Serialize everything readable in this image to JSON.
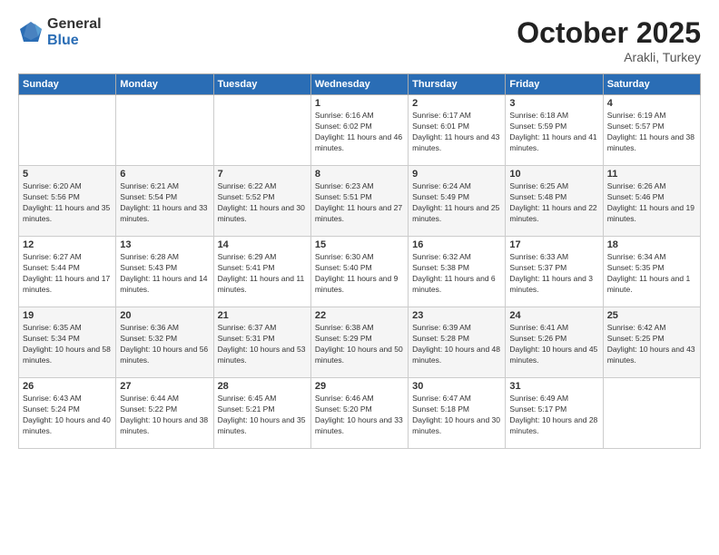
{
  "logo": {
    "general": "General",
    "blue": "Blue"
  },
  "header": {
    "month": "October 2025",
    "location": "Arakli, Turkey"
  },
  "weekdays": [
    "Sunday",
    "Monday",
    "Tuesday",
    "Wednesday",
    "Thursday",
    "Friday",
    "Saturday"
  ],
  "weeks": [
    [
      {
        "day": "",
        "sunrise": "",
        "sunset": "",
        "daylight": ""
      },
      {
        "day": "",
        "sunrise": "",
        "sunset": "",
        "daylight": ""
      },
      {
        "day": "",
        "sunrise": "",
        "sunset": "",
        "daylight": ""
      },
      {
        "day": "1",
        "sunrise": "Sunrise: 6:16 AM",
        "sunset": "Sunset: 6:02 PM",
        "daylight": "Daylight: 11 hours and 46 minutes."
      },
      {
        "day": "2",
        "sunrise": "Sunrise: 6:17 AM",
        "sunset": "Sunset: 6:01 PM",
        "daylight": "Daylight: 11 hours and 43 minutes."
      },
      {
        "day": "3",
        "sunrise": "Sunrise: 6:18 AM",
        "sunset": "Sunset: 5:59 PM",
        "daylight": "Daylight: 11 hours and 41 minutes."
      },
      {
        "day": "4",
        "sunrise": "Sunrise: 6:19 AM",
        "sunset": "Sunset: 5:57 PM",
        "daylight": "Daylight: 11 hours and 38 minutes."
      }
    ],
    [
      {
        "day": "5",
        "sunrise": "Sunrise: 6:20 AM",
        "sunset": "Sunset: 5:56 PM",
        "daylight": "Daylight: 11 hours and 35 minutes."
      },
      {
        "day": "6",
        "sunrise": "Sunrise: 6:21 AM",
        "sunset": "Sunset: 5:54 PM",
        "daylight": "Daylight: 11 hours and 33 minutes."
      },
      {
        "day": "7",
        "sunrise": "Sunrise: 6:22 AM",
        "sunset": "Sunset: 5:52 PM",
        "daylight": "Daylight: 11 hours and 30 minutes."
      },
      {
        "day": "8",
        "sunrise": "Sunrise: 6:23 AM",
        "sunset": "Sunset: 5:51 PM",
        "daylight": "Daylight: 11 hours and 27 minutes."
      },
      {
        "day": "9",
        "sunrise": "Sunrise: 6:24 AM",
        "sunset": "Sunset: 5:49 PM",
        "daylight": "Daylight: 11 hours and 25 minutes."
      },
      {
        "day": "10",
        "sunrise": "Sunrise: 6:25 AM",
        "sunset": "Sunset: 5:48 PM",
        "daylight": "Daylight: 11 hours and 22 minutes."
      },
      {
        "day": "11",
        "sunrise": "Sunrise: 6:26 AM",
        "sunset": "Sunset: 5:46 PM",
        "daylight": "Daylight: 11 hours and 19 minutes."
      }
    ],
    [
      {
        "day": "12",
        "sunrise": "Sunrise: 6:27 AM",
        "sunset": "Sunset: 5:44 PM",
        "daylight": "Daylight: 11 hours and 17 minutes."
      },
      {
        "day": "13",
        "sunrise": "Sunrise: 6:28 AM",
        "sunset": "Sunset: 5:43 PM",
        "daylight": "Daylight: 11 hours and 14 minutes."
      },
      {
        "day": "14",
        "sunrise": "Sunrise: 6:29 AM",
        "sunset": "Sunset: 5:41 PM",
        "daylight": "Daylight: 11 hours and 11 minutes."
      },
      {
        "day": "15",
        "sunrise": "Sunrise: 6:30 AM",
        "sunset": "Sunset: 5:40 PM",
        "daylight": "Daylight: 11 hours and 9 minutes."
      },
      {
        "day": "16",
        "sunrise": "Sunrise: 6:32 AM",
        "sunset": "Sunset: 5:38 PM",
        "daylight": "Daylight: 11 hours and 6 minutes."
      },
      {
        "day": "17",
        "sunrise": "Sunrise: 6:33 AM",
        "sunset": "Sunset: 5:37 PM",
        "daylight": "Daylight: 11 hours and 3 minutes."
      },
      {
        "day": "18",
        "sunrise": "Sunrise: 6:34 AM",
        "sunset": "Sunset: 5:35 PM",
        "daylight": "Daylight: 11 hours and 1 minute."
      }
    ],
    [
      {
        "day": "19",
        "sunrise": "Sunrise: 6:35 AM",
        "sunset": "Sunset: 5:34 PM",
        "daylight": "Daylight: 10 hours and 58 minutes."
      },
      {
        "day": "20",
        "sunrise": "Sunrise: 6:36 AM",
        "sunset": "Sunset: 5:32 PM",
        "daylight": "Daylight: 10 hours and 56 minutes."
      },
      {
        "day": "21",
        "sunrise": "Sunrise: 6:37 AM",
        "sunset": "Sunset: 5:31 PM",
        "daylight": "Daylight: 10 hours and 53 minutes."
      },
      {
        "day": "22",
        "sunrise": "Sunrise: 6:38 AM",
        "sunset": "Sunset: 5:29 PM",
        "daylight": "Daylight: 10 hours and 50 minutes."
      },
      {
        "day": "23",
        "sunrise": "Sunrise: 6:39 AM",
        "sunset": "Sunset: 5:28 PM",
        "daylight": "Daylight: 10 hours and 48 minutes."
      },
      {
        "day": "24",
        "sunrise": "Sunrise: 6:41 AM",
        "sunset": "Sunset: 5:26 PM",
        "daylight": "Daylight: 10 hours and 45 minutes."
      },
      {
        "day": "25",
        "sunrise": "Sunrise: 6:42 AM",
        "sunset": "Sunset: 5:25 PM",
        "daylight": "Daylight: 10 hours and 43 minutes."
      }
    ],
    [
      {
        "day": "26",
        "sunrise": "Sunrise: 6:43 AM",
        "sunset": "Sunset: 5:24 PM",
        "daylight": "Daylight: 10 hours and 40 minutes."
      },
      {
        "day": "27",
        "sunrise": "Sunrise: 6:44 AM",
        "sunset": "Sunset: 5:22 PM",
        "daylight": "Daylight: 10 hours and 38 minutes."
      },
      {
        "day": "28",
        "sunrise": "Sunrise: 6:45 AM",
        "sunset": "Sunset: 5:21 PM",
        "daylight": "Daylight: 10 hours and 35 minutes."
      },
      {
        "day": "29",
        "sunrise": "Sunrise: 6:46 AM",
        "sunset": "Sunset: 5:20 PM",
        "daylight": "Daylight: 10 hours and 33 minutes."
      },
      {
        "day": "30",
        "sunrise": "Sunrise: 6:47 AM",
        "sunset": "Sunset: 5:18 PM",
        "daylight": "Daylight: 10 hours and 30 minutes."
      },
      {
        "day": "31",
        "sunrise": "Sunrise: 6:49 AM",
        "sunset": "Sunset: 5:17 PM",
        "daylight": "Daylight: 10 hours and 28 minutes."
      },
      {
        "day": "",
        "sunrise": "",
        "sunset": "",
        "daylight": ""
      }
    ]
  ]
}
